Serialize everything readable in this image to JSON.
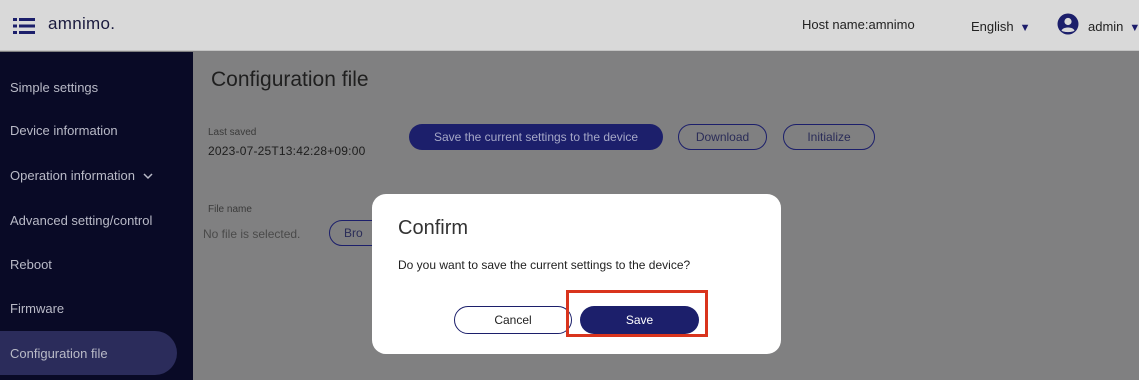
{
  "header": {
    "logo_text": "amnimo.",
    "hostname": "Host name:amnimo",
    "language": "English",
    "user": "admin",
    "menu_icon": "hamburger-menu-icon",
    "user_icon": "user-account-icon",
    "caret_glyph": "▼"
  },
  "sidebar": {
    "items": [
      {
        "label": "Simple settings"
      },
      {
        "label": "Device information"
      },
      {
        "label": "Operation information"
      },
      {
        "label": "Advanced setting/control"
      },
      {
        "label": "Reboot"
      },
      {
        "label": "Firmware"
      },
      {
        "label": "Configuration file"
      }
    ],
    "active_index": 6
  },
  "main": {
    "title": "Configuration file",
    "last_saved_label": "Last saved",
    "last_saved_value": "2023-07-25T13:42:28+09:00",
    "save_to_device_label": "Save the current settings to the device",
    "download_label": "Download",
    "initialize_label": "Initialize",
    "file_name_label": "File name",
    "file_none": "No file is selected.",
    "browse_label": "Bro"
  },
  "modal": {
    "title": "Confirm",
    "message": "Do you want to save the current settings to the device?",
    "cancel_label": "Cancel",
    "save_label": "Save"
  },
  "colors": {
    "navy": "#1c1f6b",
    "sidebar_bg": "#090a26",
    "highlight": "#d9341d",
    "overlay_gray": "#808081"
  }
}
